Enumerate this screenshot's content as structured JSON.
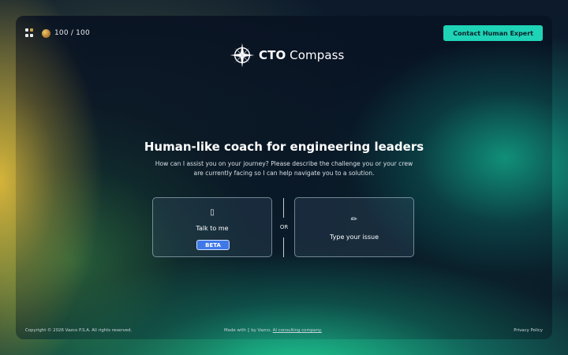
{
  "header": {
    "credits": "100 / 100",
    "contact_label": "Contact Human Expert",
    "logo_bold": "CTO",
    "logo_rest": " Compass"
  },
  "hero": {
    "title": "Human-like coach for engineering leaders",
    "subtitle": "How can I assist you on your journey? Please describe the challenge you or your crew are currently facing so I can help navigate you to a solution."
  },
  "options": {
    "voice": {
      "icon": "microphone-icon",
      "glyph": "▯",
      "label": "Talk to me",
      "badge": "BETA"
    },
    "separator": "OR",
    "text": {
      "icon": "pencil-icon",
      "glyph": "✏",
      "label": "Type your issue"
    }
  },
  "footer": {
    "copyright": "Copyright © 2026 Vazco P.S.A. All rights reserved.",
    "made_prefix": "Made with ▯ by Vazco, ",
    "made_link": "AI consulting company.",
    "privacy": "Privacy Policy"
  },
  "colors": {
    "accent": "#1ed3b6",
    "beta": "#3f78e8",
    "background": "#0b1a2a"
  }
}
